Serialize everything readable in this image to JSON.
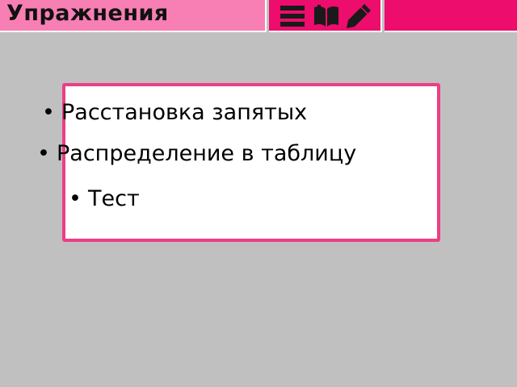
{
  "header": {
    "title": "Упражнения"
  },
  "toolbar": {
    "icons": [
      "menu-icon",
      "book-icon",
      "pencil-icon"
    ]
  },
  "menu": {
    "bullet": "•",
    "items": [
      {
        "label": "Расстановка запятых"
      },
      {
        "label": "Распределение в таблицу"
      },
      {
        "label": "Тест"
      }
    ]
  },
  "colors": {
    "background": "#c0c0c0",
    "title_bar": "#f77fb4",
    "accent": "#ec0d6c",
    "panel_border": "#ee3d86",
    "panel_bg": "#ffffff"
  }
}
